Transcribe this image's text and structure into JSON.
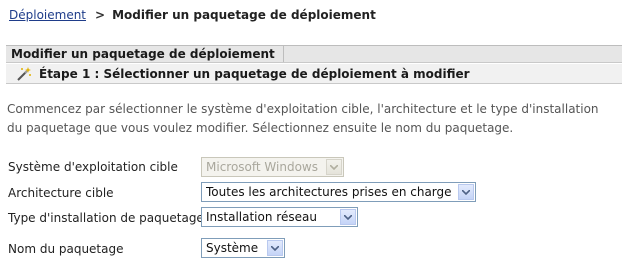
{
  "breadcrumb": {
    "parent": "Déploiement",
    "separator": ">",
    "current": "Modifier un paquetage de déploiement"
  },
  "panel": {
    "title": "Modifier un paquetage de déploiement",
    "step_title": "Étape 1 : Sélectionner un paquetage de déploiement à modifier",
    "step_icon": "wand-icon"
  },
  "intro_text": "Commencez par sélectionner le système d'exploitation cible, l'architecture et le type d'installation du paquetage que vous voulez modifier. Sélectionnez ensuite le nom du paquetage.",
  "form": {
    "os": {
      "label": "Système d'exploitation cible",
      "value": "Microsoft Windows",
      "disabled": true
    },
    "architecture": {
      "label": "Architecture cible",
      "value": "Toutes les architectures prises en charge"
    },
    "install_type": {
      "label": "Type d'installation de paquetage",
      "value": "Installation réseau"
    },
    "package_name": {
      "label": "Nom du paquetage",
      "value": "Système"
    }
  },
  "colors": {
    "link": "#1f3d8a",
    "header_bg": "#e6e6e6",
    "select_border": "#7f9db9",
    "arrow_fill": "#4d6185"
  }
}
